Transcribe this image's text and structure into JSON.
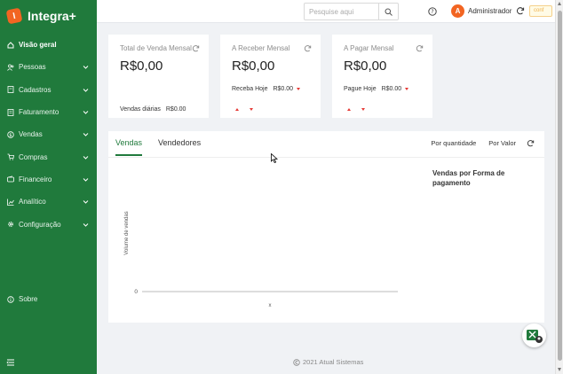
{
  "brand": {
    "name": "Integra+",
    "logo_letter": "I"
  },
  "sidebar": {
    "items": [
      {
        "label": "Visão geral",
        "icon": "home-icon",
        "active": true,
        "has_children": false
      },
      {
        "label": "Pessoas",
        "icon": "users-icon",
        "active": false,
        "has_children": true
      },
      {
        "label": "Cadastros",
        "icon": "book-icon",
        "active": false,
        "has_children": true
      },
      {
        "label": "Faturamento",
        "icon": "invoice-icon",
        "active": false,
        "has_children": true
      },
      {
        "label": "Vendas",
        "icon": "dollar-icon",
        "active": false,
        "has_children": true
      },
      {
        "label": "Compras",
        "icon": "cart-icon",
        "active": false,
        "has_children": true
      },
      {
        "label": "Financeiro",
        "icon": "wallet-icon",
        "active": false,
        "has_children": true
      },
      {
        "label": "Analítico",
        "icon": "chart-icon",
        "active": false,
        "has_children": true
      },
      {
        "label": "Configuração",
        "icon": "gear-icon",
        "active": false,
        "has_children": true
      }
    ],
    "bottom_item": {
      "label": "Sobre",
      "icon": "info-icon"
    }
  },
  "header": {
    "search_placeholder": "Pesquise aqui",
    "search_value": "",
    "avatar_letter": "A",
    "username": "Administrador",
    "badge_text": "conf"
  },
  "cards": [
    {
      "title": "Total de Venda Mensal",
      "value": "R$0,00",
      "footer_label": "Vendas diárias",
      "footer_value": "R$0.00"
    },
    {
      "title": "A Receber Mensal",
      "value": "R$0,00",
      "sub_label": "Receba Hoje",
      "sub_value": "R$0.00"
    },
    {
      "title": "A Pagar Mensal",
      "value": "R$0,00",
      "sub_label": "Pague Hoje",
      "sub_value": "R$0.00"
    }
  ],
  "panel": {
    "tabs": [
      {
        "label": "Vendas",
        "active": true
      },
      {
        "label": "Vendedores",
        "active": false
      }
    ],
    "actions": [
      "Por quantidade",
      "Por Valor"
    ],
    "pie_title": "Vendas por Forma de pagamento"
  },
  "chart_data": {
    "type": "line",
    "title": "",
    "xlabel": "x",
    "ylabel": "Volume de vendas",
    "y_ticks": [
      "0"
    ],
    "x": [],
    "series": []
  },
  "footer": {
    "text": "2021 Atual Sistemas"
  },
  "colors": {
    "sidebar": "#207a3c",
    "accent": "#207a3c",
    "avatar": "#f26522",
    "down_arrow": "#e53935"
  }
}
